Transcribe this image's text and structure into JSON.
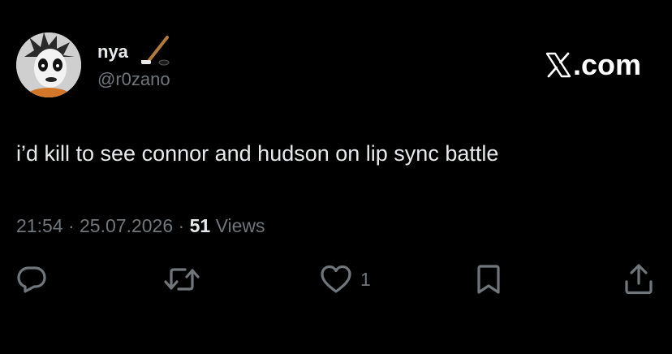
{
  "author": {
    "display_name": "nya",
    "handle": "@r0zano"
  },
  "brand": {
    "label": ".com"
  },
  "tweet": {
    "text": "i’d kill to see connor and hudson on lip sync battle",
    "time": "21:54",
    "date": "25.07.2026",
    "separator": "·",
    "views_count": "51",
    "views_label": "Views"
  },
  "actions": {
    "like_count": "1"
  },
  "colors": {
    "background": "#000000",
    "primary_text": "#e7e9ea",
    "secondary_text": "#71767b"
  },
  "icons": {
    "name_emoji": "hockey-stick-icon",
    "brand_logo": "x-logo-icon",
    "reply": "reply-icon",
    "repost": "repost-icon",
    "like": "heart-icon",
    "bookmark": "bookmark-icon",
    "share": "share-icon"
  }
}
